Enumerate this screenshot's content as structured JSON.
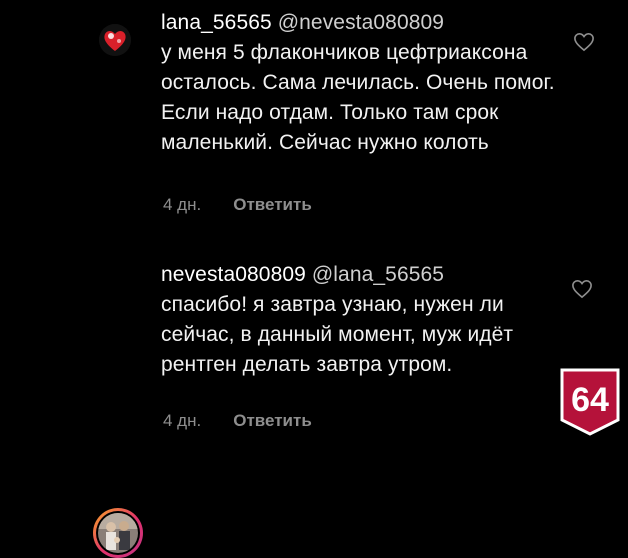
{
  "comments": [
    {
      "username": "lana_56565",
      "mention": "@nevesta080809",
      "body": "у меня 5 флакончиков цефтриаксона осталось. Сама лечилась. Очень помог. Если надо отдам. Только там срок маленький. Сейчас нужно колоть",
      "time": "4 дн.",
      "reply_label": "Ответить",
      "avatar_icon": "red-heart-avatar",
      "like_icon": "heart-outline-icon"
    },
    {
      "username": "nevesta080809",
      "mention": "@lana_56565",
      "body": "спасибо! я завтра узнаю, нужен ли сейчас, в данный момент, муж идёт рентген делать завтра утром.",
      "time": "4 дн.",
      "reply_label": "Ответить",
      "avatar_icon": "wedding-photo-avatar",
      "like_icon": "heart-outline-icon"
    }
  ],
  "badge": {
    "text": "64",
    "color": "#b5123a"
  }
}
